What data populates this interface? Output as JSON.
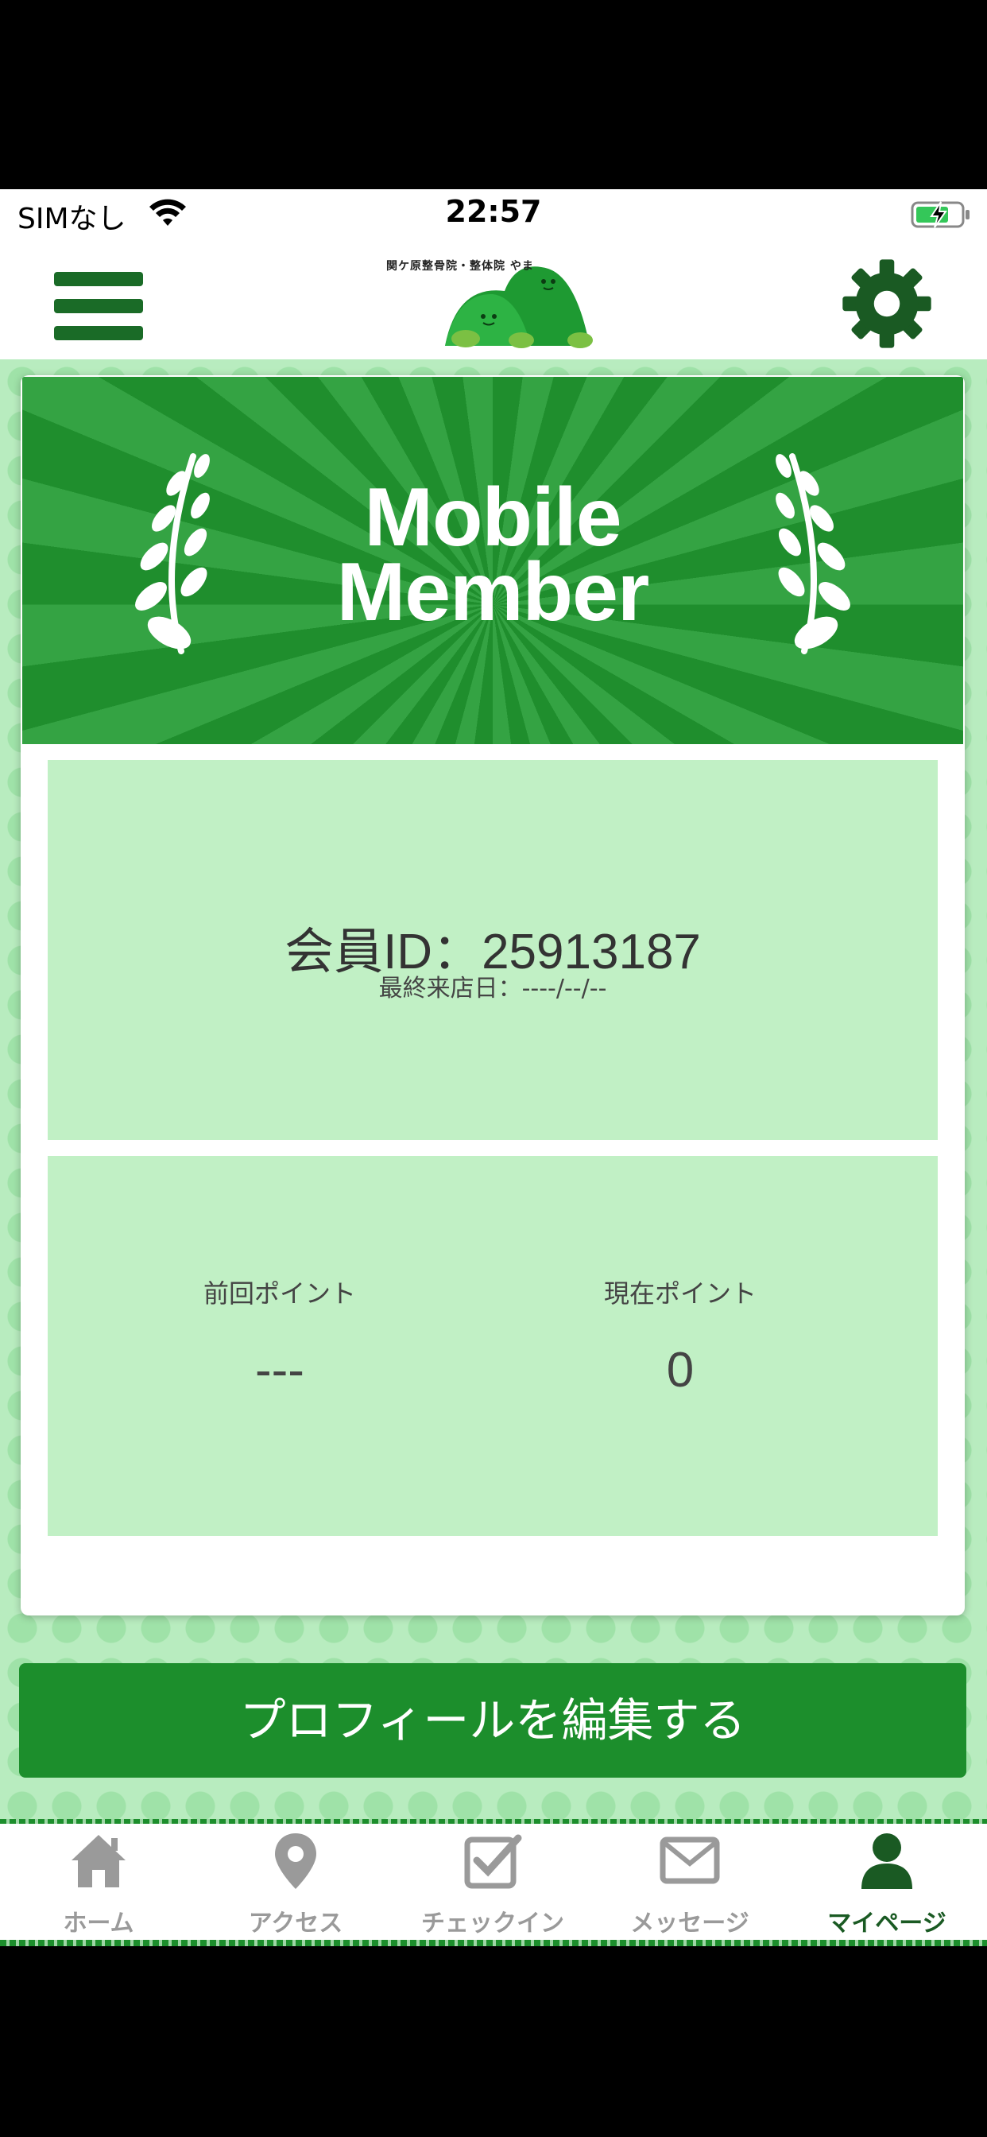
{
  "status_bar": {
    "carrier": "SIMなし",
    "time": "22:57"
  },
  "header": {
    "logo_text": "関ケ原整骨院・整体院 やま",
    "logo_kana": "やま"
  },
  "banner": {
    "line1": "Mobile",
    "line2": "Member"
  },
  "member": {
    "id_label": "会員ID：25913187",
    "last_visit": "最終来店日：----/--/--"
  },
  "points": {
    "prev_label": "前回ポイント",
    "prev_value": "---",
    "current_label": "現在ポイント",
    "current_value": "0"
  },
  "edit_button": "プロフィールを編集する",
  "tabs": [
    {
      "label": "ホーム",
      "icon": "home-icon"
    },
    {
      "label": "アクセス",
      "icon": "map-pin-icon"
    },
    {
      "label": "チェックイン",
      "icon": "checkin-icon"
    },
    {
      "label": "メッセージ",
      "icon": "mail-icon"
    },
    {
      "label": "マイページ",
      "icon": "person-icon",
      "active": true
    }
  ],
  "colors": {
    "brand_green": "#1c8e2c",
    "panel_green": "#c1f0c5",
    "bg_green": "#b8ecbf"
  }
}
